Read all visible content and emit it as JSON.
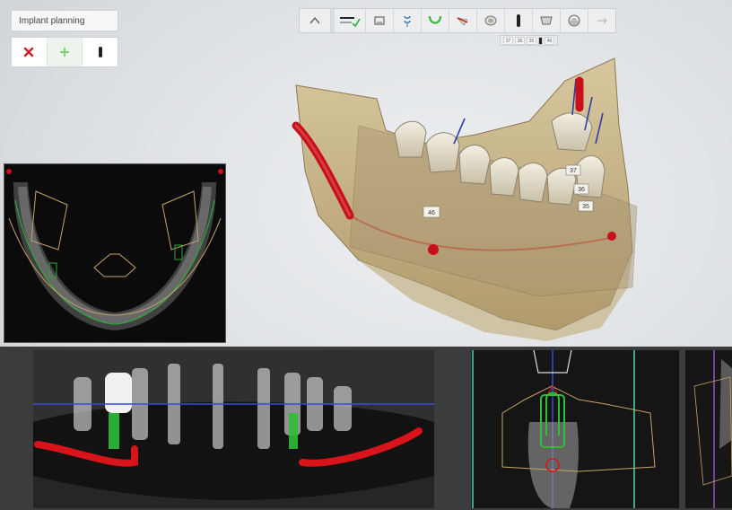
{
  "panel": {
    "title": "Implant planning",
    "tools": [
      {
        "name": "delete-implant",
        "icon": "red-x-icon"
      },
      {
        "name": "add-implant",
        "icon": "green-plus-icon"
      },
      {
        "name": "implant-tool",
        "icon": "implant-icon"
      }
    ]
  },
  "toolbar": {
    "icons": [
      "home-view-icon",
      "panoramic-curve-icon",
      "scan-icon",
      "segment-icon",
      "arch-icon",
      "nerve-icon",
      "crown-icon",
      "implant-icon",
      "sleeve-icon",
      "rotate-icon",
      "mirror-icon"
    ]
  },
  "subbar": {
    "labels": [
      "37",
      "36",
      "35",
      "",
      "46"
    ]
  },
  "scene": {
    "tooth_labels": [
      "46",
      "37",
      "36",
      "35"
    ]
  },
  "colors": {
    "bone": "#c8b48a",
    "nerve": "#d0121a",
    "implant": "#2fbf3a",
    "guide_line": "#3a4ccf",
    "background": "#dcdfe2"
  }
}
